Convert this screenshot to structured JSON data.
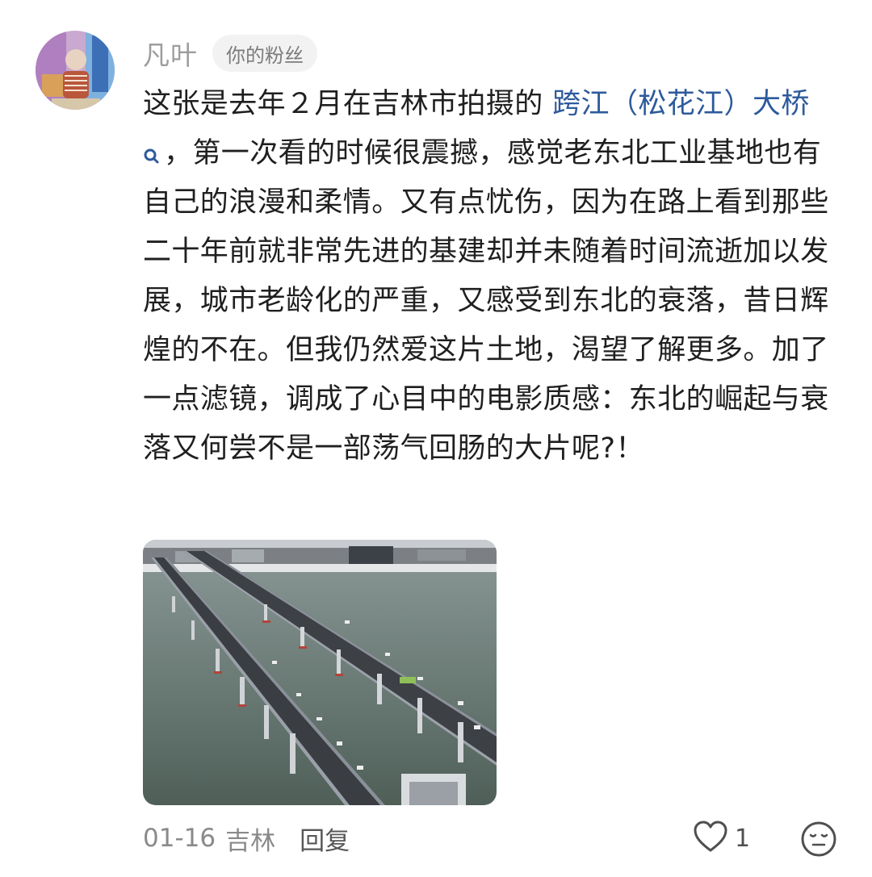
{
  "comment": {
    "username": "凡叶",
    "badge": "你的粉丝",
    "text_before": "这张是去年２月在吉林市拍摄的 ",
    "linked_term": "跨江（松花江）大桥",
    "text_after": "，第一次看的时候很震撼，感觉老东北工业基地也有自己的浪漫和柔情。又有点忧伤，因为在路上看到那些二十年前就非常先进的基建却并未随着时间流逝加以发展，城市老龄化的严重，又感受到东北的衰落，昔日辉煌的不在。但我仍然爱这片土地，渴望了解更多。加了一点滤镜，调成了心目中的电影质感：东北的崛起与衰落又何尝不是一部荡气回肠的大片呢?！",
    "linked_term_icon": "search-icon"
  },
  "footer": {
    "date": "01-16",
    "location": "吉林",
    "reply_label": "回复",
    "like_count": "1",
    "like_icon": "heart-outline-icon",
    "emoji_icon": "neutral-face-icon"
  },
  "colors": {
    "link": "#2d5a9c",
    "username": "#9d9d9d",
    "badge_bg": "#f2f2f2",
    "body_text": "#1f1f1f",
    "meta_text": "#8a8a8a"
  }
}
